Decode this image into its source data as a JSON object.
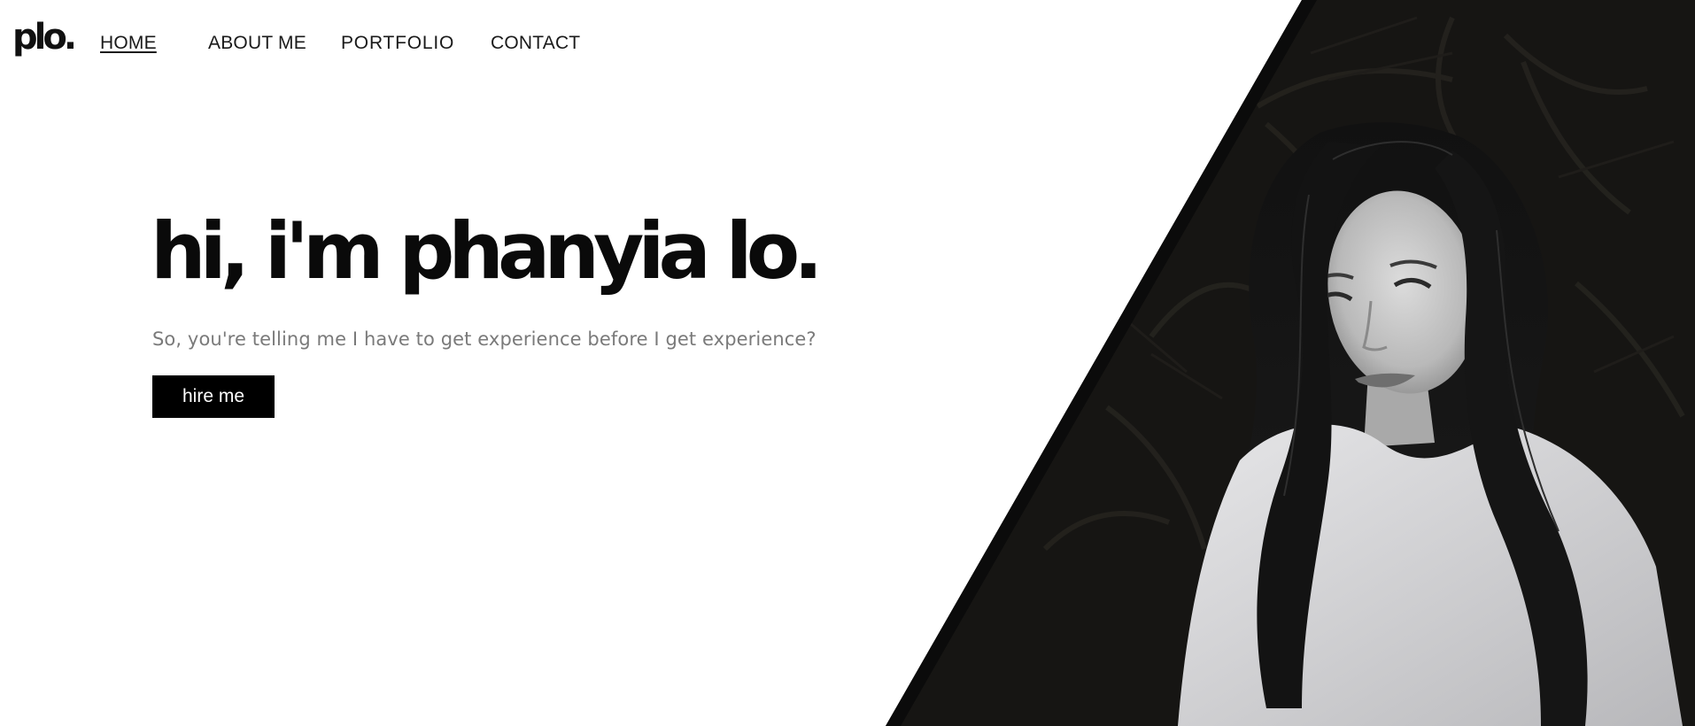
{
  "site": {
    "logo": "plo."
  },
  "nav": {
    "items": [
      {
        "label": "HOME",
        "active": true
      },
      {
        "label": "ABOUT ME",
        "active": false
      },
      {
        "label": "PORTFOLIO",
        "active": false
      },
      {
        "label": "CONTACT",
        "active": false
      }
    ]
  },
  "hero": {
    "title": "hi, i'm phanyia lo.",
    "tagline": "So, you're telling me I have to get experience before I get experience?",
    "cta_label": "hire me"
  },
  "photo": {
    "subject": "portrait-photo",
    "style": "black-and-white",
    "background_color": "#161513",
    "accent_stripe_color": "#0b0b0b"
  }
}
